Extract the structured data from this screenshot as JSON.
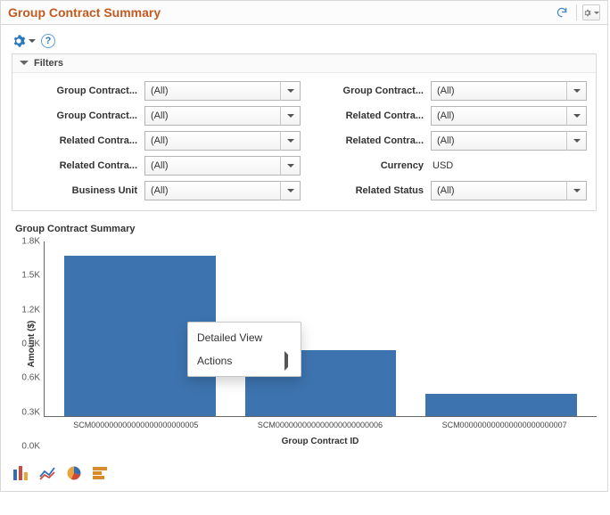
{
  "header": {
    "title": "Group Contract Summary"
  },
  "icons": {
    "refresh": "refresh-icon",
    "gear": "gear-icon",
    "gear_blue": "gear-icon",
    "help": "help-icon"
  },
  "filters": {
    "title": "Filters",
    "left": [
      {
        "label": "Group Contract...",
        "value": "(All)"
      },
      {
        "label": "Group Contract...",
        "value": "(All)"
      },
      {
        "label": "Related Contra...",
        "value": "(All)"
      },
      {
        "label": "Related Contra...",
        "value": "(All)"
      },
      {
        "label": "Business Unit",
        "value": "(All)"
      }
    ],
    "right": [
      {
        "label": "Group Contract...",
        "value": "(All)"
      },
      {
        "label": "Related Contra...",
        "value": "(All)"
      },
      {
        "label": "Related Contra...",
        "value": "(All)"
      },
      {
        "label": "Currency",
        "value": "USD",
        "static": true
      },
      {
        "label": "Related Status",
        "value": "(All)"
      }
    ]
  },
  "chart": {
    "title": "Group Contract Summary",
    "ylabel": "Amount ($)",
    "xlabel": "Group Contract ID",
    "yticks": [
      "1.8K",
      "1.5K",
      "1.2K",
      "0.9K",
      "0.6K",
      "0.3K",
      "0.0K"
    ]
  },
  "chart_data": {
    "type": "bar",
    "categories": [
      "SCM000000000000000000000005",
      "SCM000000000000000000000006",
      "SCM000000000000000000000007"
    ],
    "values": [
      1650,
      680,
      230
    ],
    "title": "Group Contract Summary",
    "xlabel": "Group Contract ID",
    "ylabel": "Amount ($)",
    "ylim": [
      0,
      1800
    ],
    "legend": false
  },
  "context_menu": {
    "detailed": "Detailed View",
    "actions": "Actions"
  },
  "chart_types": [
    "bar",
    "line",
    "pie",
    "hbar"
  ]
}
